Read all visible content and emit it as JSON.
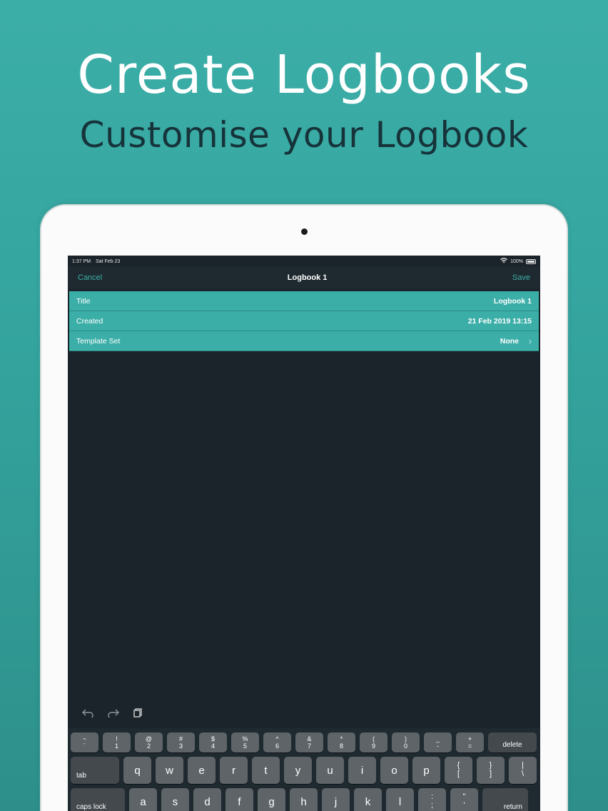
{
  "headline": "Create Logbooks",
  "subheadline": "Customise your Logbook",
  "status_bar": {
    "time": "1:37 PM",
    "date": "Sat Feb 23",
    "battery": "100%"
  },
  "nav": {
    "cancel": "Cancel",
    "title": "Logbook 1",
    "save": "Save"
  },
  "form": {
    "rows": [
      {
        "label": "Title",
        "value": "Logbook 1"
      },
      {
        "label": "Created",
        "value": "21 Feb 2019 13:15"
      },
      {
        "label": "Template Set",
        "value": "None"
      }
    ]
  },
  "toolbar": {
    "undo_icon": "undo-icon",
    "redo_icon": "redo-icon",
    "paste_icon": "paste-icon"
  },
  "keyboard": {
    "number_row": [
      {
        "top": "~",
        "bottom": "`"
      },
      {
        "top": "!",
        "bottom": "1"
      },
      {
        "top": "@",
        "bottom": "2"
      },
      {
        "top": "#",
        "bottom": "3"
      },
      {
        "top": "$",
        "bottom": "4"
      },
      {
        "top": "%",
        "bottom": "5"
      },
      {
        "top": "^",
        "bottom": "6"
      },
      {
        "top": "&",
        "bottom": "7"
      },
      {
        "top": "*",
        "bottom": "8"
      },
      {
        "top": "(",
        "bottom": "9"
      },
      {
        "top": ")",
        "bottom": "0"
      },
      {
        "top": "_",
        "bottom": "-"
      },
      {
        "top": "+",
        "bottom": "="
      }
    ],
    "delete": "delete",
    "tab": "tab",
    "top_row": [
      "q",
      "w",
      "e",
      "r",
      "t",
      "y",
      "u",
      "i",
      "o",
      "p"
    ],
    "top_row_symbols": [
      {
        "top": "{",
        "bottom": "["
      },
      {
        "top": "}",
        "bottom": "]"
      },
      {
        "top": "|",
        "bottom": "\\"
      }
    ],
    "caps_lock": "caps lock",
    "home_row": [
      "a",
      "s",
      "d",
      "f",
      "g",
      "h",
      "j",
      "k",
      "l"
    ],
    "home_row_symbols": [
      {
        "top": ":",
        "bottom": ";"
      },
      {
        "top": "\"",
        "bottom": "'"
      }
    ],
    "return": "return"
  },
  "colors": {
    "accent": "#3caea8",
    "background_dark": "#1c242b",
    "key": "#5e6468"
  }
}
